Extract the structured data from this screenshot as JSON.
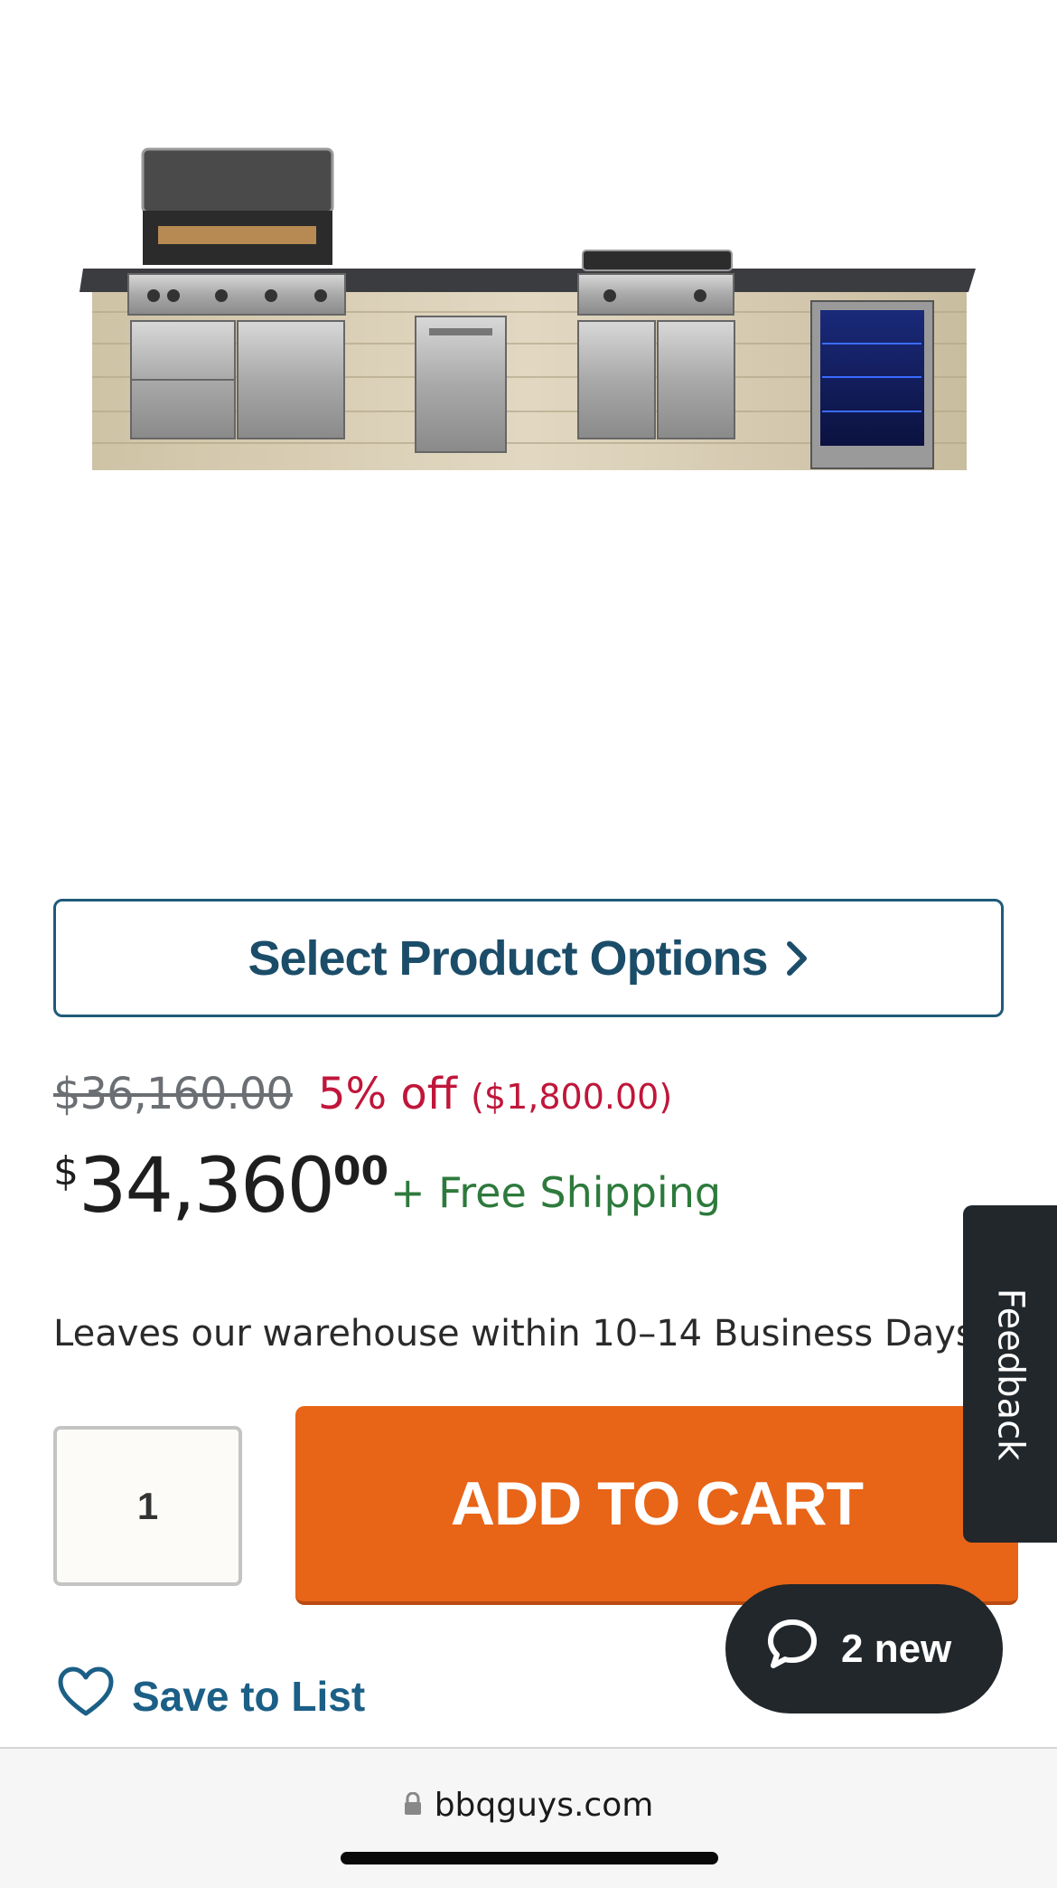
{
  "product": {
    "image_alt": "outdoor kitchen island with grills and beverage fridge"
  },
  "options_button": {
    "label": "Select Product Options"
  },
  "pricing": {
    "original_price": "$36,160.00",
    "discount_percent": "5% off",
    "discount_amount": "($1,800.00)",
    "price_symbol": "$",
    "price_whole": "34,360",
    "price_cents": "00",
    "shipping": "+ Free Shipping"
  },
  "availability": "Leaves our warehouse within 10–14 Business Days",
  "cart": {
    "quantity": "1",
    "add_to_cart_label": "ADD TO CART"
  },
  "feedback_tab": {
    "label": "Feedback"
  },
  "save_to_list": {
    "label": "Save to List"
  },
  "chat": {
    "label": "2 new"
  },
  "browser": {
    "url": "bbqguys.com"
  },
  "colors": {
    "accent_blue": "#1b4d69",
    "cta_orange": "#e86417",
    "discount_red": "#c0163a",
    "shipping_green": "#2d7a3c"
  }
}
